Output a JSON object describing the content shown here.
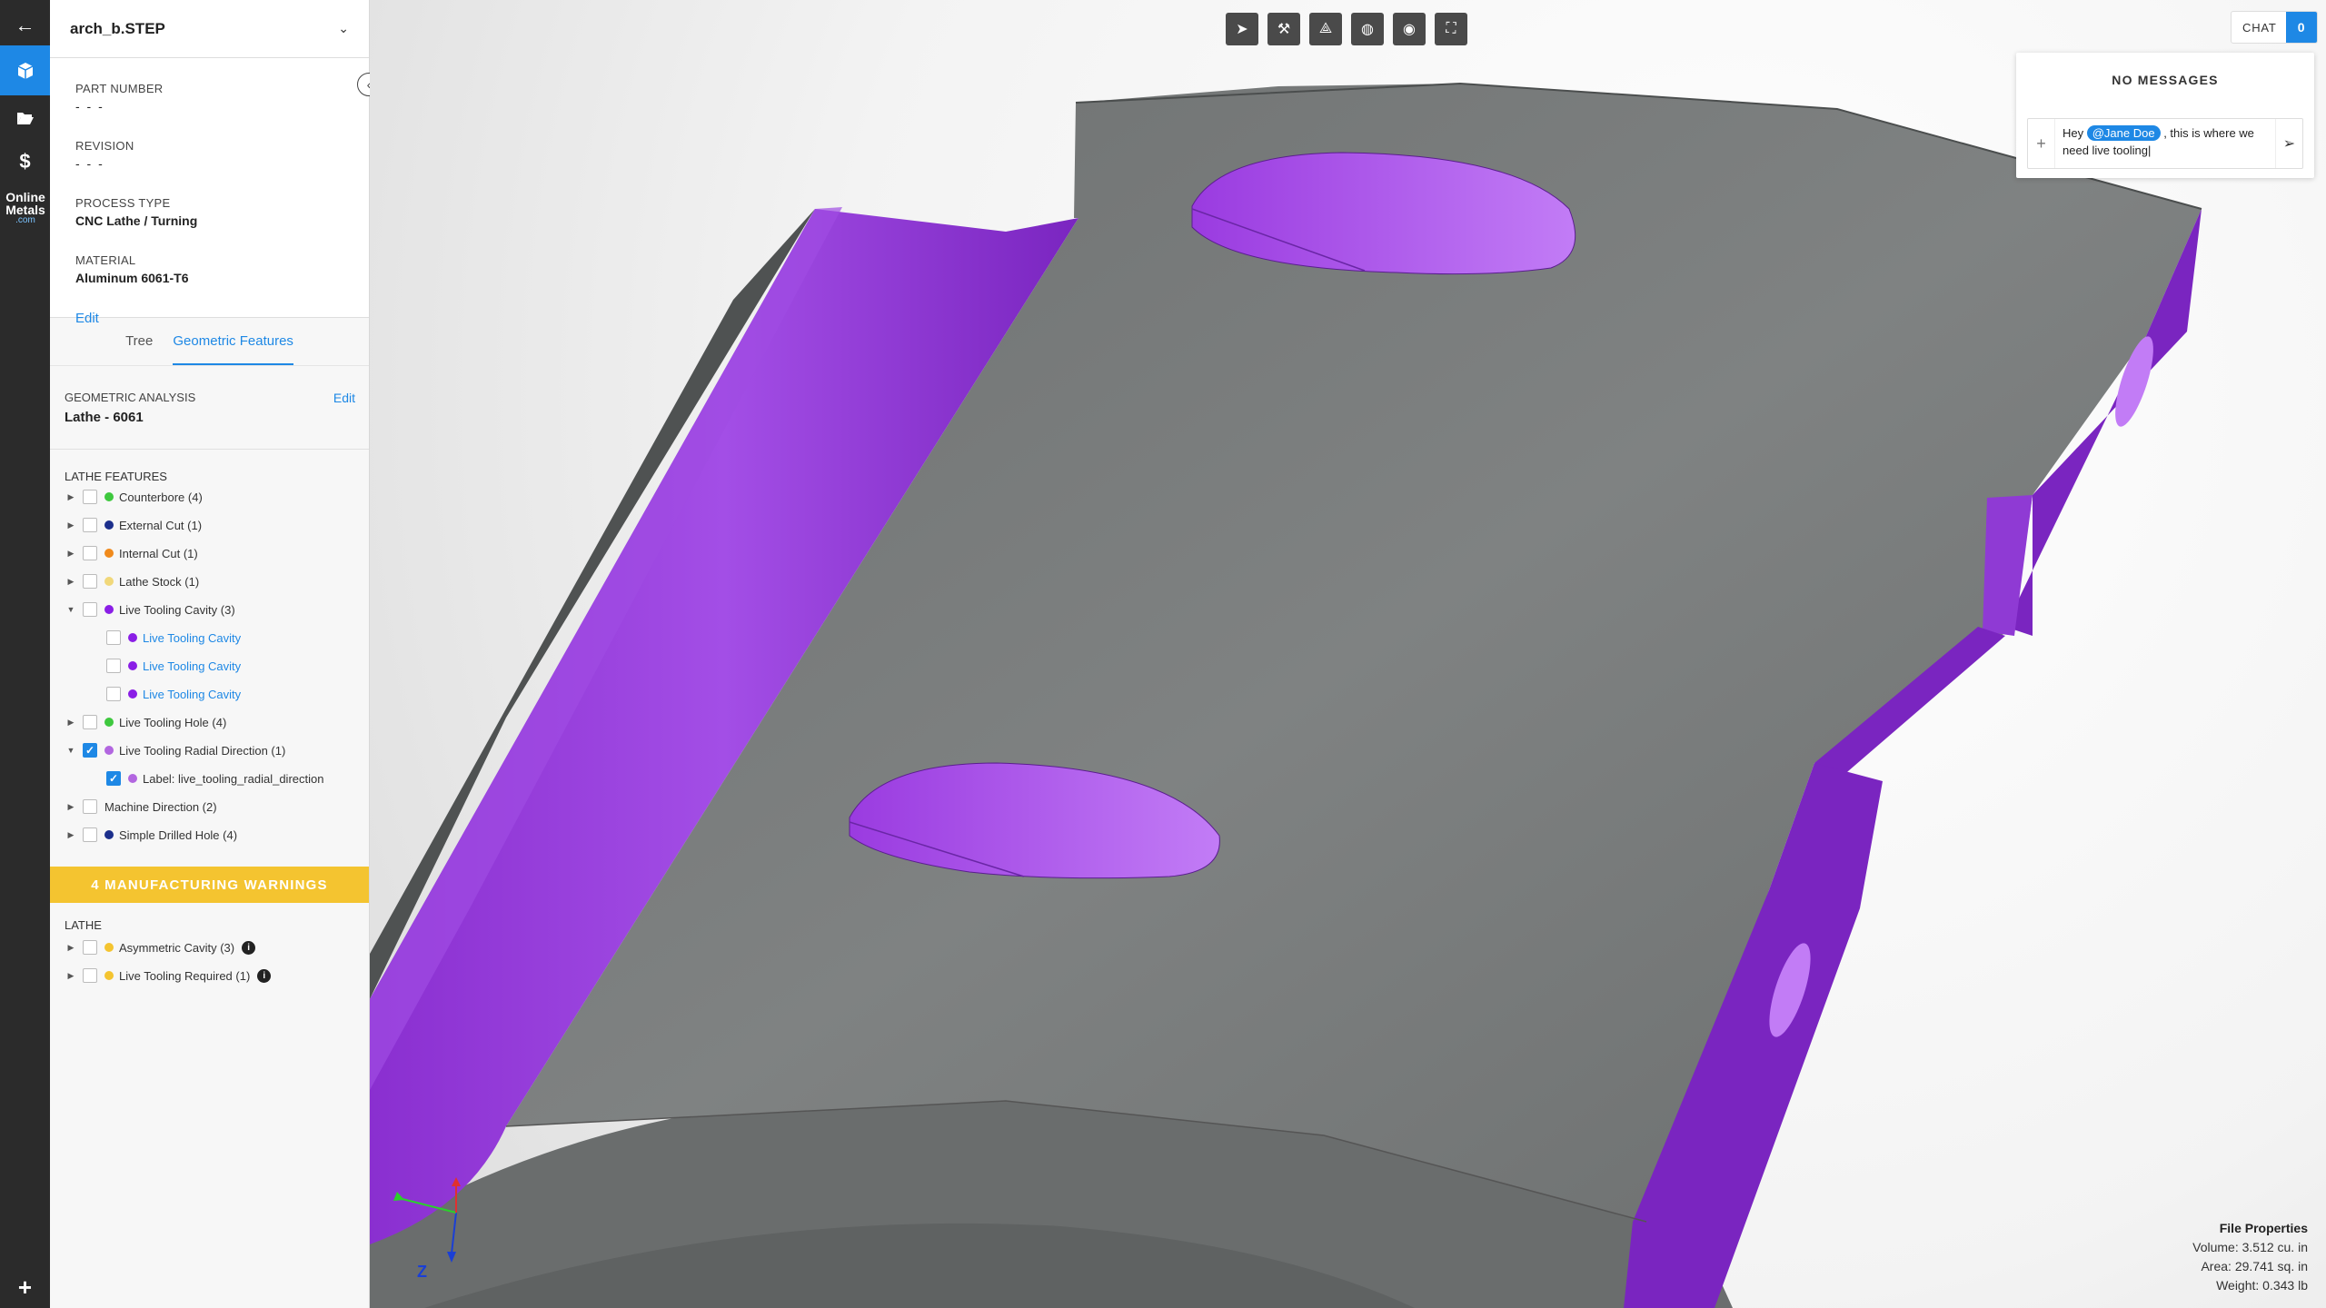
{
  "rail": {
    "items": [
      {
        "icon": "back-arrow-icon"
      },
      {
        "icon": "cube-icon"
      },
      {
        "icon": "folder-open-icon"
      },
      {
        "icon": "dollar-icon"
      }
    ],
    "logo_line1": "Online",
    "logo_line2": "Metals",
    "logo_line3": ".com",
    "add_icon": "plus-icon"
  },
  "panel": {
    "file_name": "arch_b.STEP",
    "part_number_label": "PART NUMBER",
    "part_number_value": "- - -",
    "revision_label": "REVISION",
    "revision_value": "- - -",
    "process_type_label": "PROCESS TYPE",
    "process_type_value": "CNC Lathe / Turning",
    "material_label": "MATERIAL",
    "material_value": "Aluminum 6061-T6",
    "edit_label": "Edit"
  },
  "tabs": [
    {
      "label": "Tree",
      "active": false
    },
    {
      "label": "Geometric Features",
      "active": true
    }
  ],
  "geometric_analysis": {
    "label": "GEOMETRIC ANALYSIS",
    "value": "Lathe - 6061",
    "edit_label": "Edit"
  },
  "lathe_features": {
    "title": "LATHE FEATURES",
    "items": [
      {
        "label": "Counterbore (4)",
        "color": "#3ec83e",
        "expanded": false,
        "checked": false
      },
      {
        "label": "External Cut (1)",
        "color": "#1c2f8c",
        "expanded": false,
        "checked": false
      },
      {
        "label": "Internal Cut (1)",
        "color": "#f08a1c",
        "expanded": false,
        "checked": false
      },
      {
        "label": "Lathe Stock (1)",
        "color": "#f1d87a",
        "expanded": false,
        "checked": false
      },
      {
        "label": "Live Tooling Cavity (3)",
        "color": "#8a1ee6",
        "expanded": true,
        "checked": false
      },
      {
        "label": "Live Tooling Cavity",
        "color": "#8a1ee6",
        "child": true,
        "link": true,
        "checked": false
      },
      {
        "label": "Live Tooling Cavity",
        "color": "#8a1ee6",
        "child": true,
        "link": true,
        "checked": false
      },
      {
        "label": "Live Tooling Cavity",
        "color": "#8a1ee6",
        "child": true,
        "link": true,
        "checked": false
      },
      {
        "label": "Live Tooling Hole (4)",
        "color": "#3ec83e",
        "expanded": false,
        "checked": false
      },
      {
        "label": "Live Tooling Radial Direction (1)",
        "color": "#b266e0",
        "expanded": true,
        "checked": true
      },
      {
        "label": "Label: live_tooling_radial_direction",
        "color": "#b266e0",
        "child": true,
        "link": false,
        "checked": true
      },
      {
        "label": "Machine Direction (2)",
        "color": null,
        "expanded": false,
        "checked": false
      },
      {
        "label": "Simple Drilled Hole (4)",
        "color": "#1c2f8c",
        "expanded": false,
        "checked": false
      }
    ]
  },
  "warnings": {
    "banner": "4 MANUFACTURING WARNINGS",
    "section_title": "LATHE",
    "items": [
      {
        "label": "Asymmetric Cavity (3)",
        "color": "#f4c430"
      },
      {
        "label": "Live Tooling Required (1)",
        "color": "#f4c430"
      }
    ],
    "info_glyph": "i"
  },
  "toolbar": {
    "tools": [
      {
        "icon": "pointer-icon",
        "glyph": "➤"
      },
      {
        "icon": "hammer-icon",
        "glyph": "⚒"
      },
      {
        "icon": "measure-icon",
        "glyph": "⟁"
      },
      {
        "icon": "globe-icon",
        "glyph": "◍"
      },
      {
        "icon": "eye-hide-icon",
        "glyph": "◉"
      },
      {
        "icon": "fit-screen-icon",
        "glyph": "⛶"
      }
    ]
  },
  "chat": {
    "button_label": "CHAT",
    "count": "0",
    "empty_text": "NO MESSAGES",
    "input_prefix": "Hey ",
    "mention": "@Jane Doe",
    "input_suffix": " , this is where we need live tooling|"
  },
  "axis": {
    "z_label": "Z"
  },
  "file_properties": {
    "title": "File Properties",
    "volume": "Volume: 3.512 cu. in",
    "area": "Area: 29.741 sq. in",
    "weight": "Weight: 0.343 lb"
  },
  "colors": {
    "accent": "#1e88e5",
    "warning": "#f4c430",
    "model_gray": "#7a7d7d",
    "feature_purple": "#9b3fd9"
  }
}
